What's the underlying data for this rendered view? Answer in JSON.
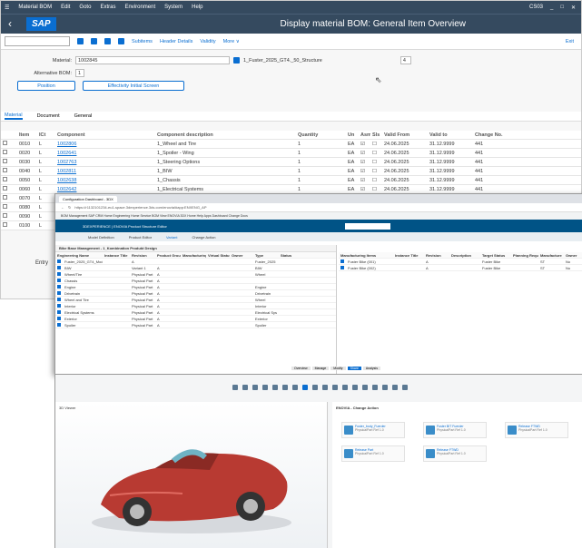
{
  "sap": {
    "menu": [
      "Material BOM",
      "Edit",
      "Goto",
      "Extras",
      "Environment",
      "System",
      "Help"
    ],
    "menu_right": [
      "CS03",
      "_",
      "□",
      "✕"
    ],
    "logo": "SAP",
    "title": "Display material BOM: General Item Overview",
    "toolbar": [
      "Subitems",
      "Header Details",
      "Validity",
      "More ∨"
    ],
    "toolbar_exit": "Exit",
    "material_label": "Material:",
    "material_value": "1002845",
    "material_desc": "1_Fuster_2025_GT4._50_Structure",
    "material_side": "4",
    "altbom_label": "Alternative BOM:",
    "altbom_value": "1",
    "btn_position": "Position",
    "btn_effectivity": "Effectivity Initial Screen",
    "tabs": [
      "Material",
      "Document",
      "General"
    ],
    "headers": [
      "Item",
      "ICt",
      "Component",
      "Component description",
      "Quantity",
      "Un",
      "Asm",
      "Sls",
      "Valid From",
      "Valid to",
      "Change No."
    ],
    "rows": [
      [
        "0010",
        "L",
        "1002806",
        "1_Wheel and Tire",
        "1",
        "EA",
        "☑",
        "☐",
        "24.06.2025",
        "31.12.9999",
        "441"
      ],
      [
        "0020",
        "L",
        "1002641",
        "1_Spoiler - Wing",
        "1",
        "EA",
        "☑",
        "☐",
        "24.06.2025",
        "31.12.9999",
        "441"
      ],
      [
        "0030",
        "L",
        "1002763",
        "1_Steering Options",
        "1",
        "EA",
        "☑",
        "☐",
        "24.06.2025",
        "31.12.9999",
        "441"
      ],
      [
        "0040",
        "L",
        "1002811",
        "1_BIW",
        "1",
        "EA",
        "☑",
        "☐",
        "24.06.2025",
        "31.12.9999",
        "441"
      ],
      [
        "0050",
        "L",
        "1002638",
        "1_Chassis",
        "1",
        "EA",
        "☑",
        "☐",
        "24.06.2025",
        "31.12.9999",
        "441"
      ],
      [
        "0060",
        "L",
        "1002642",
        "1_Electrical Systems",
        "1",
        "EA",
        "☑",
        "☐",
        "24.06.2025",
        "31.12.9999",
        "441"
      ],
      [
        "0070",
        "L",
        "",
        "",
        "",
        "",
        "",
        "",
        "",
        "",
        ""
      ],
      [
        "0080",
        "L",
        "",
        "",
        "",
        "",
        "",
        "",
        "",
        "",
        ""
      ],
      [
        "0090",
        "L",
        "",
        "",
        "",
        "",
        "",
        "",
        "",
        "",
        ""
      ],
      [
        "0100",
        "L",
        "",
        "",
        "",
        "",
        "",
        "",
        "",
        "",
        ""
      ]
    ],
    "entry_label": "Entry"
  },
  "browser": {
    "tab": "Configuration Dashboard - 3DX",
    "url": "https://r1132101234-eu1-space.3dexperience.3ds.com/enovia/#app:ENXENG_AP",
    "bookmarks": "BOM Management  SAP  CRM Home  Engineering Home  Service  BOM View  ENOVIA  3DX Home  Help  Apps  Dashboard  Change  Docs",
    "app_title": "3DEXPERIENCE | ENOVIA Product Structure Editor",
    "subtabs": [
      "Model Definition",
      "Product Editor",
      "Variant",
      "Change Action"
    ],
    "left_title": "Bike Base Management - 1_Kombination Produkt Design",
    "left_headers": [
      "Engineering Name",
      "Instance Title",
      "Revision",
      "Product Group",
      "Manufacturing",
      "Virtual Status",
      "Owner",
      "Type",
      "Status"
    ],
    "left_rows": [
      [
        "Fuster_2025_GT4_Model",
        "",
        "A",
        "",
        "",
        "",
        "",
        "Fuster_2025",
        "",
        "active mspBT"
      ],
      [
        "BIW",
        "",
        "Variant 1",
        "A",
        "",
        "",
        "",
        "BIW",
        "",
        "active mspBT"
      ],
      [
        "Wheel/Tire",
        "",
        "Physical Part",
        "A",
        "",
        "",
        "",
        "Wheel",
        "",
        "active mspBT"
      ],
      [
        "Chassis",
        "",
        "Physical Part",
        "A",
        "",
        "",
        "",
        "",
        "",
        "active mspBT"
      ],
      [
        "Engine",
        "",
        "Physical Part",
        "A",
        "",
        "",
        "",
        "Engine",
        "",
        "active mspBT"
      ],
      [
        "Drivetrain",
        "",
        "Physical Part",
        "A",
        "",
        "",
        "",
        "Drivetrain",
        "",
        "active mspBT"
      ],
      [
        "Wheel and Tire",
        "",
        "Physical Part",
        "A",
        "",
        "",
        "",
        "Wheel",
        "",
        "active mspBT"
      ],
      [
        "Interior",
        "",
        "Physical Part",
        "A",
        "",
        "",
        "",
        "Interior",
        "",
        "active mspBT"
      ],
      [
        "Electrical Systems",
        "",
        "Physical Part",
        "A",
        "",
        "",
        "",
        "Electrical Sys",
        "",
        "active mspBT"
      ],
      [
        "Exterior",
        "",
        "Physical Part",
        "A",
        "",
        "",
        "",
        "Exterior",
        "",
        "active mspBT"
      ],
      [
        "Spoiler",
        "",
        "Physical Part",
        "A",
        "",
        "",
        "",
        "Spoiler",
        "",
        "active mspBT"
      ]
    ],
    "right_headers": [
      "Manufacturing Items",
      "Instance Title",
      "Revision",
      "Description",
      "Target Status",
      "Planning Required",
      "Manufacture",
      "Owner"
    ],
    "right_rows": [
      [
        "Fuster Bike (001)",
        "",
        "A",
        "",
        "Fuster Bike",
        "",
        "ST",
        "No"
      ],
      [
        "Fuster Bike (002)",
        "",
        "A",
        "",
        "Fuster Bike",
        "",
        "ST",
        "No"
      ]
    ],
    "bottom_tabs": [
      "Overview",
      "Manage",
      "Modify",
      "Share",
      "Analysis"
    ],
    "viewer_title": "3D Viewer",
    "viewer_pages": [
      "1",
      "2"
    ],
    "change_title": "ENOVIA - Change Action",
    "cards": [
      {
        "t": "Fuster_body_Fuerder",
        "d": "PhysicalPart  Ref 1.0"
      },
      {
        "t": "Fuster BIT Fuerder",
        "d": "PhysicalPart  Ref 1.0"
      },
      {
        "t": "Release FTWD",
        "d": "PhysicalPart  Ref 1.0"
      },
      {
        "t": "Release Part",
        "d": "PhysicalPart  Ref 1.0"
      },
      {
        "t": "Release FTWD",
        "d": "PhysicalPart  Ref 1.0"
      }
    ]
  }
}
